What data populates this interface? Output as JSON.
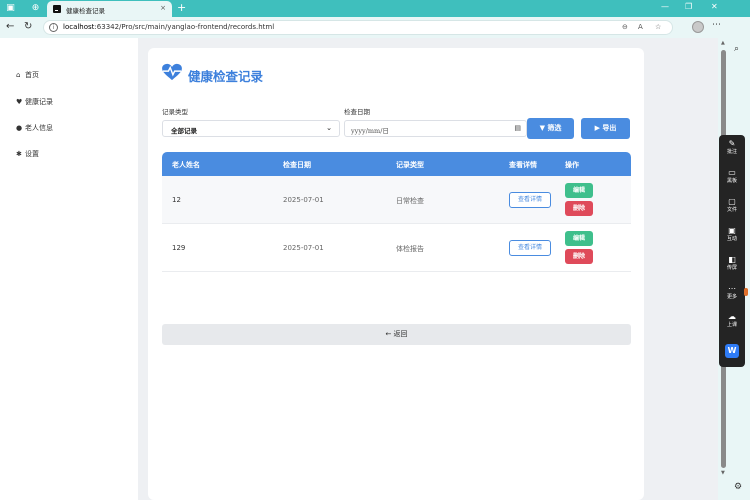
{
  "browser": {
    "tab_title": "健康检查记录",
    "tab_close": "×",
    "new_tab": "+",
    "url_host": "localhost",
    "url_rest": ":63342/Pro/src/main/yanglao-frontend/records.html",
    "info_glyph": "i"
  },
  "sidebar": {
    "items": [
      {
        "icon": "home-icon",
        "glyph": "⌂",
        "label": "首页"
      },
      {
        "icon": "heartbeat-icon",
        "glyph": "♥",
        "label": "健康记录"
      },
      {
        "icon": "user-icon",
        "glyph": "●",
        "label": "老人信息"
      },
      {
        "icon": "gear-icon",
        "glyph": "✱",
        "label": "设置"
      }
    ]
  },
  "page": {
    "title": "健康检查记录",
    "accent": "#3d80dc"
  },
  "filters": {
    "type_label": "记录类型",
    "type_value": "全部记录",
    "date_label": "检查日期",
    "date_placeholder": "yyyy/mm/日",
    "filter_button": "筛选",
    "export_button": "导出"
  },
  "table": {
    "headers": [
      "老人姓名",
      "检查日期",
      "记录类型",
      "查看详情",
      "操作"
    ],
    "rows": [
      {
        "name": "12",
        "date": "2025-07-01",
        "type": "日常检查"
      },
      {
        "name": "129",
        "date": "2025-07-01",
        "type": "体检报告"
      }
    ],
    "detail_label": "查看详情",
    "edit_label": "编辑",
    "delete_label": "删除"
  },
  "back_button": "返回",
  "float_toolbar": {
    "items": [
      {
        "icon": "pen-icon",
        "glyph": "✎",
        "label": "批注"
      },
      {
        "icon": "whiteboard-icon",
        "glyph": "▭",
        "label": "黑板"
      },
      {
        "icon": "file-icon",
        "glyph": "▢",
        "label": "文件"
      },
      {
        "icon": "interact-icon",
        "glyph": "▣",
        "label": "互动"
      },
      {
        "icon": "screen-icon",
        "glyph": "◧",
        "label": "传屏"
      },
      {
        "icon": "more-icon",
        "glyph": "⋯",
        "label": "更多"
      },
      {
        "icon": "upload-icon",
        "glyph": "☁",
        "label": "上课"
      }
    ]
  },
  "colors": {
    "primary": "#4a8ce0",
    "success": "#3fbf8c",
    "danger": "#df4a5a"
  }
}
